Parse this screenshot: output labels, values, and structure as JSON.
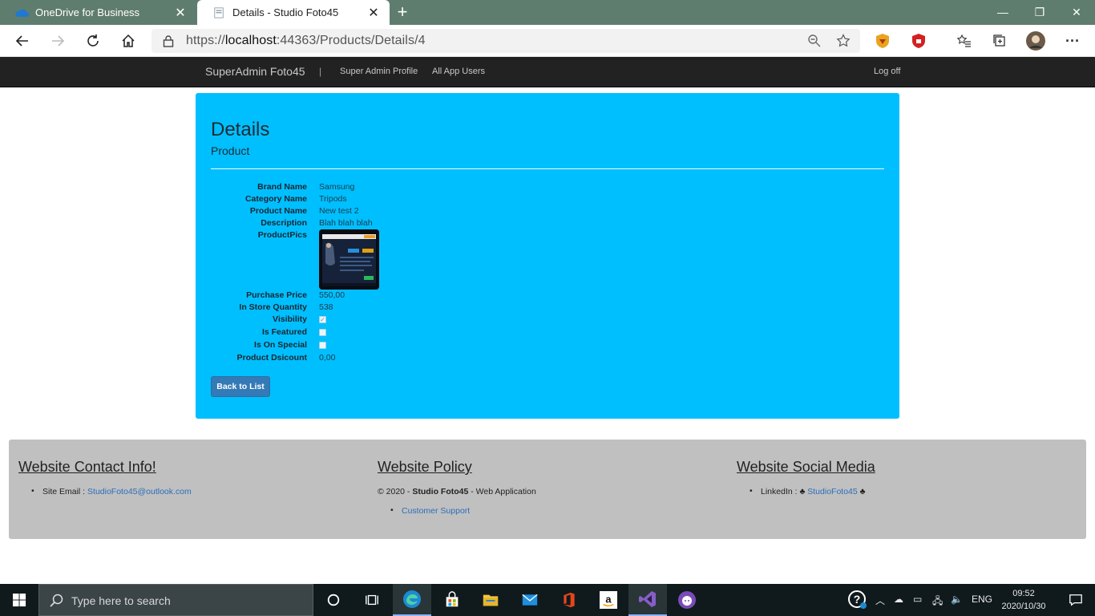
{
  "browser": {
    "tabs": [
      {
        "title": "OneDrive for Business",
        "active": false
      },
      {
        "title": "Details - Studio Foto45",
        "active": true
      }
    ],
    "url_prefix": "https://",
    "url_host": "localhost",
    "url_rest": ":44363/Products/Details/4"
  },
  "navbar": {
    "brand": "SuperAdmin Foto45",
    "separator": "|",
    "links": [
      "Super Admin Profile",
      "All App Users"
    ],
    "logoff": "Log off"
  },
  "page": {
    "heading": "Details",
    "subheading": "Product",
    "fields": {
      "brand_label": "Brand Name",
      "brand_value": "Samsung",
      "category_label": "Category Name",
      "category_value": "Tripods",
      "product_label": "Product Name",
      "product_value": "New test 2",
      "description_label": "Description",
      "description_value": "Blah blah blah",
      "pics_label": "ProductPics",
      "price_label": "Purchase Price",
      "price_value": "550,00",
      "qty_label": "In Store Quantity",
      "qty_value": "538",
      "visibility_label": "Visibility",
      "visibility_checked": true,
      "featured_label": "Is Featured",
      "featured_checked": false,
      "special_label": "Is On Special",
      "special_checked": false,
      "discount_label": "Product Dsicount",
      "discount_value": "0,00"
    },
    "back_button": "Back to List"
  },
  "footer": {
    "contact": {
      "heading": "Website Contact Info!",
      "email_label": "Site Email : ",
      "email": "StudioFoto45@outlook.com"
    },
    "policy": {
      "heading": "Website Policy",
      "copyright_prefix": "© 2020 - ",
      "company": "Studio Foto45",
      "copyright_suffix": " - Web Application",
      "support_link": "Customer Support"
    },
    "social": {
      "heading": "Website Social Media",
      "linkedin_label": "LinkedIn : ♣ ",
      "linkedin_link": "StudioFoto45",
      "linkedin_suffix": " ♣"
    }
  },
  "taskbar": {
    "search_placeholder": "Type here to search",
    "language": "ENG",
    "time": "09:52",
    "date": "2020/10/30"
  },
  "colors": {
    "panel": "#00bfff",
    "navbar": "#222222",
    "footer": "#c0c0c0",
    "button": "#337ab7",
    "link": "#2a6ebb"
  }
}
